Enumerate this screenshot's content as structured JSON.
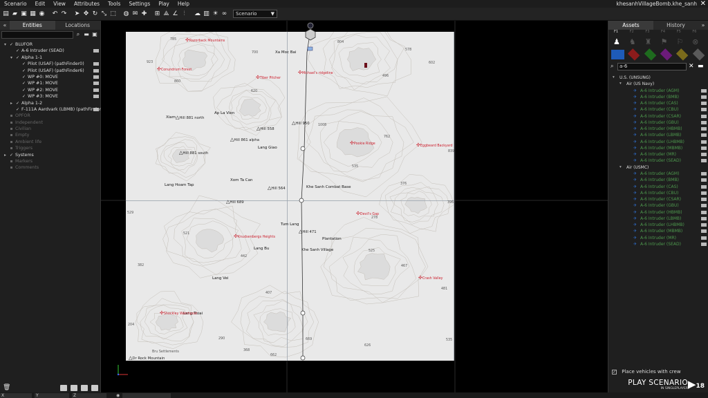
{
  "menu": {
    "items": [
      "Scenario",
      "Edit",
      "View",
      "Attributes",
      "Tools",
      "Settings",
      "Play",
      "Help"
    ],
    "window_title": "khesanhVillageBomb.khe_sanh"
  },
  "toolbar": {
    "scenario_select": "Scenario"
  },
  "left_panel": {
    "tab_entities": "Entities",
    "tab_locations": "Locations",
    "tree": [
      {
        "label": "BLUFOR",
        "indent": 0,
        "exp": "▾",
        "dim": false
      },
      {
        "label": "A-6 Intruder (SEAD)",
        "indent": 1,
        "exp": "",
        "dim": false
      },
      {
        "label": "Alpha 1-1",
        "indent": 1,
        "exp": "▾",
        "dim": false
      },
      {
        "label": "Pilot (USAF) (pathFinder0)",
        "indent": 2,
        "exp": "",
        "dim": false
      },
      {
        "label": "Pilot (USAF) (pathFinder6)",
        "indent": 2,
        "exp": "",
        "dim": false
      },
      {
        "label": "WP #0: MOVE",
        "indent": 2,
        "exp": "",
        "dim": false
      },
      {
        "label": "WP #1: MOVE",
        "indent": 2,
        "exp": "",
        "dim": false
      },
      {
        "label": "WP #2: MOVE",
        "indent": 2,
        "exp": "",
        "dim": false
      },
      {
        "label": "WP #3: MOVE",
        "indent": 2,
        "exp": "",
        "dim": false
      },
      {
        "label": "Alpha 1-2",
        "indent": 1,
        "exp": "▸",
        "dim": false
      },
      {
        "label": "F-111A Aardvark (LBMB) (pathFinder)",
        "indent": 1,
        "exp": "",
        "dim": false
      },
      {
        "label": "OPFOR",
        "indent": 0,
        "exp": "",
        "dim": true
      },
      {
        "label": "Independent",
        "indent": 0,
        "exp": "",
        "dim": true
      },
      {
        "label": "Civilian",
        "indent": 0,
        "exp": "",
        "dim": true
      },
      {
        "label": "Empty",
        "indent": 0,
        "exp": "",
        "dim": true
      },
      {
        "label": "Ambient life",
        "indent": 0,
        "exp": "",
        "dim": true
      },
      {
        "label": "Triggers",
        "indent": 0,
        "exp": "",
        "dim": true
      },
      {
        "label": "Systems",
        "indent": 0,
        "exp": "▸",
        "dim": false
      },
      {
        "label": "Markers",
        "indent": 0,
        "exp": "",
        "dim": true
      },
      {
        "label": "Comments",
        "indent": 0,
        "exp": "",
        "dim": true
      }
    ]
  },
  "map": {
    "places": [
      {
        "t": "Xa Moc Bai",
        "c": "big"
      },
      {
        "t": "Xiam",
        "c": "big"
      },
      {
        "t": "Ap La Vien",
        "c": "big"
      },
      {
        "t": "Lang Giao",
        "c": "big"
      },
      {
        "t": "Xom Ta Can",
        "c": "big"
      },
      {
        "t": "Lang Hoam Tap",
        "c": "big"
      },
      {
        "t": "Khe Sanh Combat Base",
        "c": "big"
      },
      {
        "t": "Tum Lang",
        "c": "big"
      },
      {
        "t": "Plantation",
        "c": "big"
      },
      {
        "t": "Lang Bu",
        "c": "big"
      },
      {
        "t": "Khe Sanh Village",
        "c": "big"
      },
      {
        "t": "Lang Vei",
        "c": "big"
      },
      {
        "t": "Lang Troai",
        "c": "big"
      },
      {
        "t": "Bru Settlements",
        "c": "dim"
      }
    ],
    "hills": [
      {
        "t": "Hill 881 north"
      },
      {
        "t": "Hill 950"
      },
      {
        "t": "Hill 558"
      },
      {
        "t": "Hill 861 alpha"
      },
      {
        "t": "Hill 881 south"
      },
      {
        "t": "Hill 564"
      },
      {
        "t": "Hill 689"
      },
      {
        "t": "Hill 471"
      },
      {
        "t": "Dr Rock Mountain"
      }
    ],
    "red_markers": [
      {
        "t": "Razorback Mountains"
      },
      {
        "t": "Conundrum Forest"
      },
      {
        "t": "Tiber Pitcher"
      },
      {
        "t": "Michael's ridgeline"
      },
      {
        "t": "Pookie Ridge"
      },
      {
        "t": "Eggbeard Backyard"
      },
      {
        "t": "Devil's Gap"
      },
      {
        "t": "Knudsenbergs Heights"
      },
      {
        "t": "Crash Valley"
      },
      {
        "t": "Shockley Watchpost"
      }
    ],
    "elevations": [
      {
        "t": "785"
      },
      {
        "t": "700"
      },
      {
        "t": "804"
      },
      {
        "t": "578"
      },
      {
        "t": "923"
      },
      {
        "t": "496"
      },
      {
        "t": "860"
      },
      {
        "t": "620"
      },
      {
        "t": "1008"
      },
      {
        "t": "762"
      },
      {
        "t": "839"
      },
      {
        "t": "535"
      },
      {
        "t": "376"
      },
      {
        "t": "396"
      },
      {
        "t": "529"
      },
      {
        "t": "278"
      },
      {
        "t": "521"
      },
      {
        "t": "442"
      },
      {
        "t": "525"
      },
      {
        "t": "382"
      },
      {
        "t": "467"
      },
      {
        "t": "481"
      },
      {
        "t": "407"
      },
      {
        "t": "204"
      },
      {
        "t": "290"
      },
      {
        "t": "368"
      },
      {
        "t": "662"
      },
      {
        "t": "669"
      },
      {
        "t": "626"
      },
      {
        "t": "535"
      },
      {
        "t": "602"
      }
    ],
    "grid_line_color": "#9aa3ad"
  },
  "right_panel": {
    "tab_assets": "Assets",
    "tab_history": "History",
    "fkeys": [
      "F1",
      "F2",
      "F3",
      "F4",
      "F5",
      "F6"
    ],
    "side_colors": [
      "#1e5bb8",
      "#8c1b1b",
      "#1e6b1e",
      "#6b1b7a",
      "#7a6a1b",
      "#5a5a5a"
    ],
    "search_value": "a-6",
    "tree": [
      {
        "label": "U.S. (UNSUNG)",
        "type": "group",
        "level": 0
      },
      {
        "label": "Air (US Navy)",
        "type": "group",
        "level": 1
      },
      {
        "label": "A-6 Intruder (AGM)",
        "type": "item"
      },
      {
        "label": "A-6 Intruder (BMB)",
        "type": "item"
      },
      {
        "label": "A-6 Intruder (CAS)",
        "type": "item"
      },
      {
        "label": "A-6 Intruder (CBU)",
        "type": "item"
      },
      {
        "label": "A-6 Intruder (CSAR)",
        "type": "item"
      },
      {
        "label": "A-6 Intruder (GBU)",
        "type": "item"
      },
      {
        "label": "A-6 Intruder (HBMB)",
        "type": "item"
      },
      {
        "label": "A-6 Intruder (LBMB)",
        "type": "item"
      },
      {
        "label": "A-6 Intruder (LHBMB)",
        "type": "item"
      },
      {
        "label": "A-6 Intruder (MBMB)",
        "type": "item"
      },
      {
        "label": "A-6 Intruder (MR)",
        "type": "item"
      },
      {
        "label": "A-6 Intruder (SEAD)",
        "type": "item"
      },
      {
        "label": "Air (USMC)",
        "type": "group",
        "level": 1
      },
      {
        "label": "A-6 Intruder (AGM)",
        "type": "item"
      },
      {
        "label": "A-6 Intruder (BMB)",
        "type": "item"
      },
      {
        "label": "A-6 Intruder (CAS)",
        "type": "item"
      },
      {
        "label": "A-6 Intruder (CBU)",
        "type": "item"
      },
      {
        "label": "A-6 Intruder (CSAR)",
        "type": "item"
      },
      {
        "label": "A-6 Intruder (GBU)",
        "type": "item"
      },
      {
        "label": "A-6 Intruder (HBMB)",
        "type": "item"
      },
      {
        "label": "A-6 Intruder (LBMB)",
        "type": "item"
      },
      {
        "label": "A-6 Intruder (LHBMB)",
        "type": "item"
      },
      {
        "label": "A-6 Intruder (MBMB)",
        "type": "item"
      },
      {
        "label": "A-6 Intruder (MR)",
        "type": "item"
      },
      {
        "label": "A-6 Intruder (SEAD)",
        "type": "item"
      }
    ],
    "place_vehicles": "Place vehicles with crew",
    "place_vehicles_checked": true,
    "play_main": "PLAY SCENARIO",
    "play_sub": "IN SINGLEPLAYER",
    "play_logo": "18"
  },
  "status": {
    "x_label": "X",
    "y_label": "Y",
    "z_label": "Z"
  }
}
